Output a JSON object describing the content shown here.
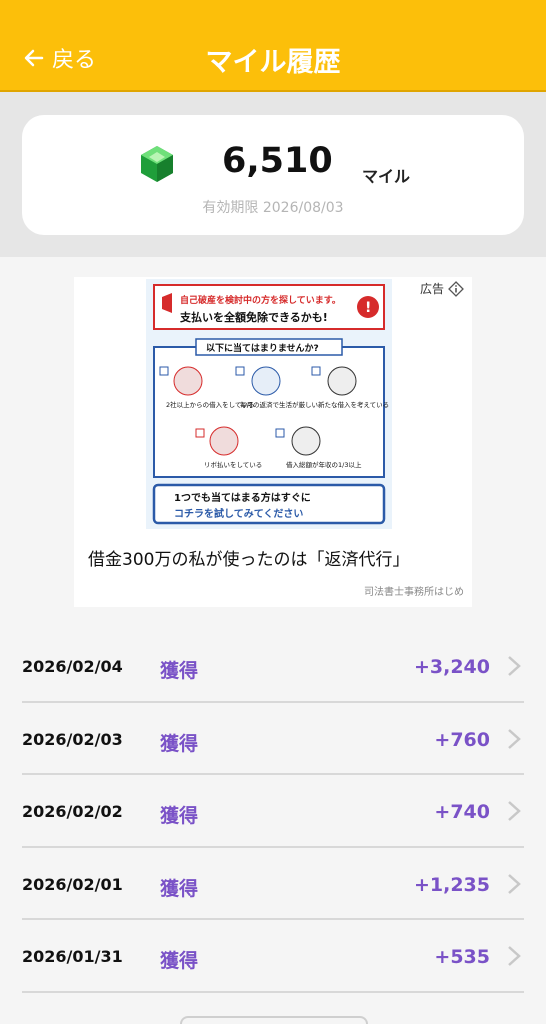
{
  "header": {
    "back_label": "戻る",
    "title": "マイル履歴"
  },
  "summary": {
    "value": "6,510",
    "unit": "マイル",
    "expiry": "有効期限 2026/08/03"
  },
  "ad": {
    "tag": "広告",
    "banner_top": "自己破産を検討中の方を探しています。",
    "banner_main": "支払いを全額免除できるかも!",
    "banner_question": "以下に当てはまりませんか?",
    "banner_items": [
      "2社以上からの借入をしている",
      "毎月の返済で生活が厳しい",
      "新たな借入を考えている",
      "リボ払いをしている",
      "借入総額が年収の1/3以上"
    ],
    "banner_cta_1": "1つでも当てはまる方はすぐに",
    "banner_cta_2": "コチラを試してみてください",
    "headline": "借金300万の私が使ったのは「返済代行」",
    "sponsor": "司法書士事務所はじめ"
  },
  "history": [
    {
      "date": "2026/02/04",
      "type": "獲得",
      "amount": "+3,240"
    },
    {
      "date": "2026/02/03",
      "type": "獲得",
      "amount": "+760"
    },
    {
      "date": "2026/02/02",
      "type": "獲得",
      "amount": "+740"
    },
    {
      "date": "2026/02/01",
      "type": "獲得",
      "amount": "+1,235"
    },
    {
      "date": "2026/01/31",
      "type": "獲得",
      "amount": "+535"
    }
  ],
  "colors": {
    "header": "#fcbf0a",
    "accent": "#7a52c7"
  }
}
